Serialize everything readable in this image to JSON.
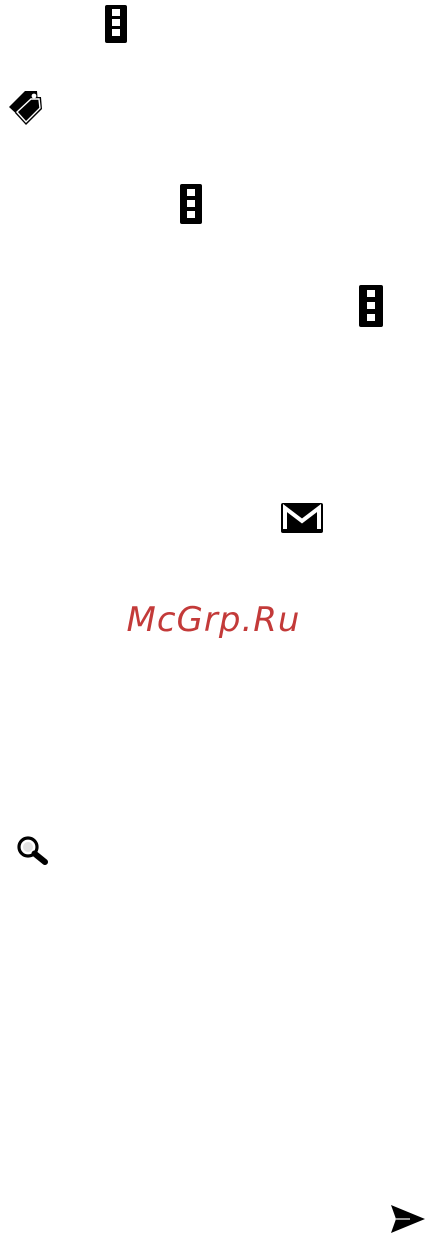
{
  "icons": {
    "overflow_1": "more-vert-icon",
    "tag": "tag-icon",
    "overflow_2": "more-vert-icon",
    "overflow_3": "more-vert-icon",
    "mail": "gmail-icon",
    "search": "search-icon",
    "send": "send-icon"
  },
  "colors": {
    "watermark": "#c0302f",
    "icon": "#000000",
    "background": "#ffffff"
  },
  "watermark": {
    "text": "McGrp.Ru"
  }
}
